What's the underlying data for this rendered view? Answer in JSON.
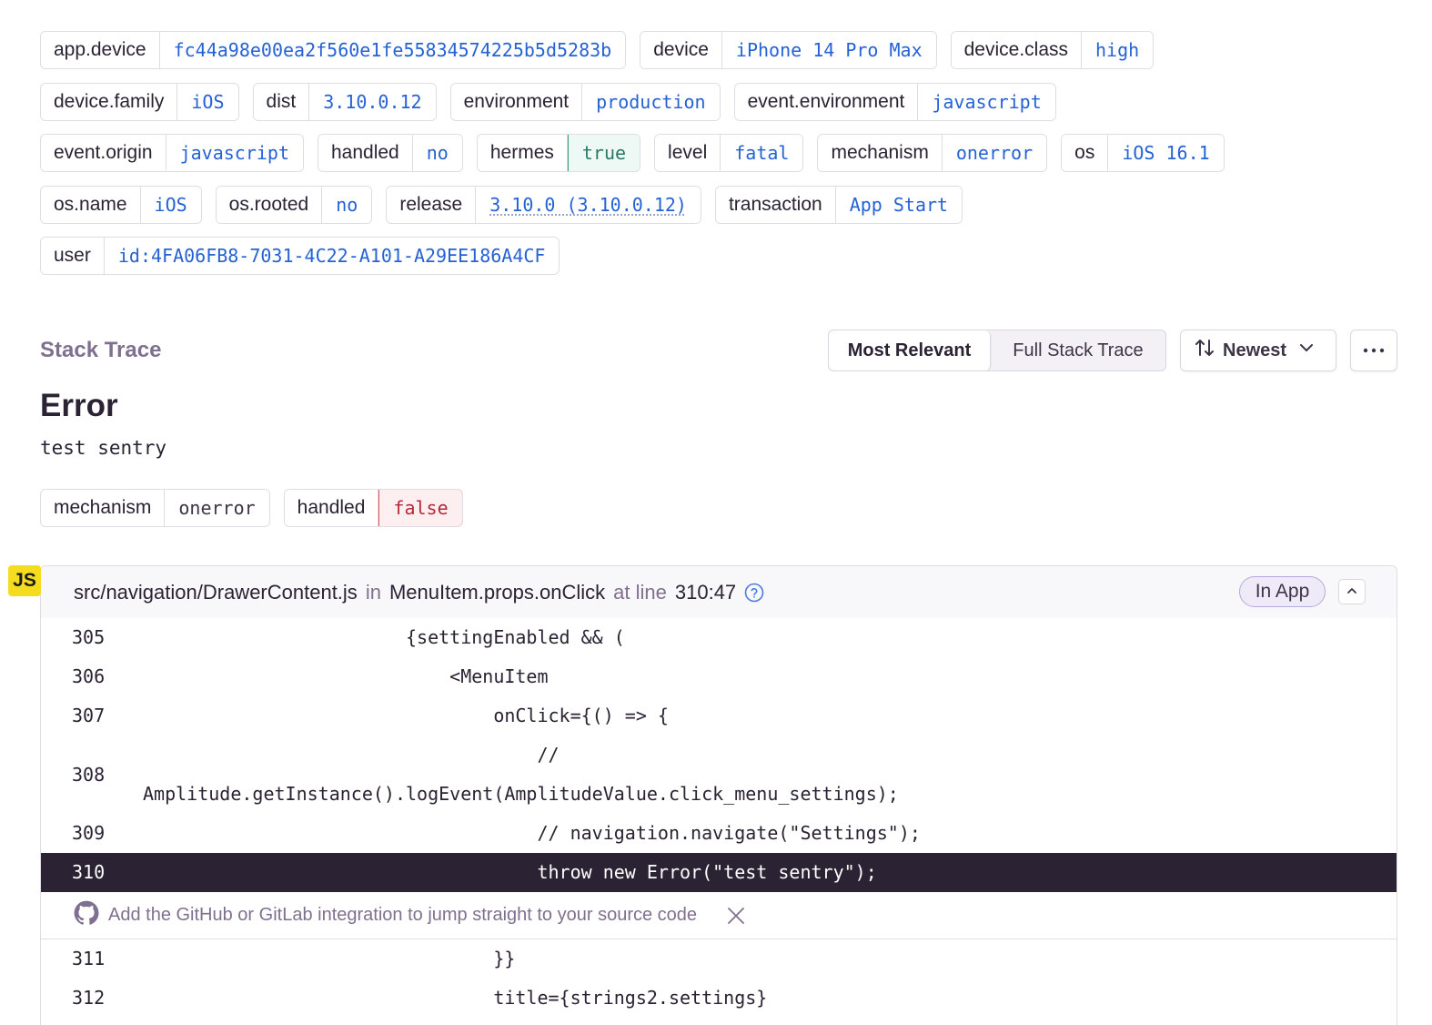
{
  "tags": [
    [
      {
        "key": "app.device",
        "value": "fc44a98e00ea2f560e1fe55834574225b5d5283b"
      },
      {
        "key": "device",
        "value": "iPhone 14 Pro Max"
      },
      {
        "key": "device.class",
        "value": "high"
      }
    ],
    [
      {
        "key": "device.family",
        "value": "iOS"
      },
      {
        "key": "dist",
        "value": "3.10.0.12"
      },
      {
        "key": "environment",
        "value": "production"
      },
      {
        "key": "event.environment",
        "value": "javascript"
      }
    ],
    [
      {
        "key": "event.origin",
        "value": "javascript"
      },
      {
        "key": "handled",
        "value": "no"
      },
      {
        "key": "hermes",
        "value": "true"
      },
      {
        "key": "level",
        "value": "fatal"
      },
      {
        "key": "mechanism",
        "value": "onerror"
      },
      {
        "key": "os",
        "value": "iOS 16.1"
      }
    ],
    [
      {
        "key": "os.name",
        "value": "iOS"
      },
      {
        "key": "os.rooted",
        "value": "no"
      },
      {
        "key": "release",
        "value": "3.10.0 (3.10.0.12)"
      },
      {
        "key": "transaction",
        "value": "App Start"
      }
    ],
    [
      {
        "key": "user",
        "value": "id:4FA06FB8-7031-4C22-A101-A29EE186A4CF"
      }
    ]
  ],
  "stack_trace": {
    "title": "Stack Trace",
    "view_options": [
      "Most Relevant",
      "Full Stack Trace"
    ],
    "active_view": "Most Relevant",
    "sort_label": "Newest",
    "more_label": "..."
  },
  "exception": {
    "type": "Error",
    "value": "test sentry",
    "mechanism_tags": [
      {
        "key": "mechanism",
        "value": "onerror"
      },
      {
        "key": "handled",
        "value": "false"
      }
    ]
  },
  "frame": {
    "platform_badge": "JS",
    "filename": "src/navigation/DrawerContent.js",
    "in_label": "in",
    "function": "MenuItem.props.onClick",
    "at_line_label": "at line",
    "location": "310:47",
    "in_app_label": "In App",
    "lines": [
      {
        "no": "305",
        "code": "                        {settingEnabled && ("
      },
      {
        "no": "306",
        "code": "                            <MenuItem"
      },
      {
        "no": "307",
        "code": "                                onClick={() => {"
      },
      {
        "no": "308",
        "code": "                                    //",
        "code2": "Amplitude.getInstance().logEvent(AmplitudeValue.click_menu_settings);"
      },
      {
        "no": "309",
        "code": "                                    // navigation.navigate(\"Settings\");"
      },
      {
        "no": "310",
        "code": "                                    throw new Error(\"test sentry\");"
      },
      {
        "no": "311",
        "code": "                                }}"
      },
      {
        "no": "312",
        "code": "                                title={strings2.settings}"
      }
    ],
    "integration_banner": "Add the GitHub or GitLab integration to jump straight to your source code"
  },
  "colors": {
    "accent_value": "#2562d4",
    "active_line_bg": "#2b2233",
    "js_badge": "#f5dc1f"
  }
}
